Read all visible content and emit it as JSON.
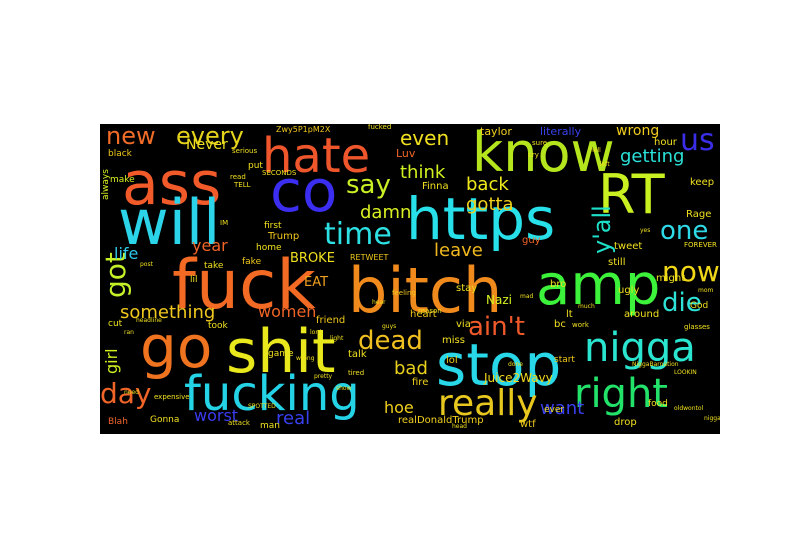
{
  "words": [
    {
      "text": "hate",
      "color": "#f0562c"
    },
    {
      "text": "know",
      "color": "#b5e61d"
    },
    {
      "text": "ass",
      "color": "#f25a2a"
    },
    {
      "text": "co",
      "color": "#3b2ef0"
    },
    {
      "text": "RT",
      "color": "#c9f020"
    },
    {
      "text": "will",
      "color": "#2bd4e8"
    },
    {
      "text": "https",
      "color": "#27e0ea"
    },
    {
      "text": "fuck",
      "color": "#f26a24"
    },
    {
      "text": "bitch",
      "color": "#f08a1c"
    },
    {
      "text": "amp",
      "color": "#3cf23a"
    },
    {
      "text": "go",
      "color": "#f07420"
    },
    {
      "text": "shit",
      "color": "#e8e81c"
    },
    {
      "text": "stop",
      "color": "#28d8e8"
    },
    {
      "text": "nigga",
      "color": "#2ae6d0"
    },
    {
      "text": "fucking",
      "color": "#25d3e6"
    },
    {
      "text": "really",
      "color": "#e8c81e"
    },
    {
      "text": "right",
      "color": "#22e26a"
    },
    {
      "text": "time",
      "color": "#2ce0e4"
    },
    {
      "text": "now",
      "color": "#f0d818"
    },
    {
      "text": "say",
      "color": "#c8f024"
    },
    {
      "text": "new",
      "color": "#f06c28"
    },
    {
      "text": "every",
      "color": "#e6d41c"
    },
    {
      "text": "us",
      "color": "#3a2ee8"
    },
    {
      "text": "one",
      "color": "#2edae8"
    },
    {
      "text": "y'all",
      "color": "#1ee0c8"
    },
    {
      "text": "die",
      "color": "#2ee2d8"
    },
    {
      "text": "ain't",
      "color": "#f05a2a"
    },
    {
      "text": "dead",
      "color": "#f0c020"
    },
    {
      "text": "got",
      "color": "#c4f028"
    },
    {
      "text": "day",
      "color": "#f06428"
    },
    {
      "text": "even",
      "color": "#f0e020"
    },
    {
      "text": "think",
      "color": "#d0f020"
    },
    {
      "text": "back",
      "color": "#f0ea1c"
    },
    {
      "text": "gotta",
      "color": "#f0d01c"
    },
    {
      "text": "damn",
      "color": "#d8f022"
    },
    {
      "text": "leave",
      "color": "#f0b81e"
    },
    {
      "text": "getting",
      "color": "#2ae0d8"
    },
    {
      "text": "wrong",
      "color": "#f0cc1c"
    },
    {
      "text": "something",
      "color": "#f0c81e"
    },
    {
      "text": "women",
      "color": "#f06426"
    },
    {
      "text": "bad",
      "color": "#e8d01c"
    },
    {
      "text": "want",
      "color": "#3a40f0"
    },
    {
      "text": "worst",
      "color": "#3a3cf0"
    },
    {
      "text": "real",
      "color": "#3840f0"
    },
    {
      "text": "hoe",
      "color": "#f0d01c"
    },
    {
      "text": "girl",
      "color": "#d0f020"
    },
    {
      "text": "life",
      "color": "#2cc8e8"
    },
    {
      "text": "year",
      "color": "#f06428"
    },
    {
      "text": "Never",
      "color": "#f0e020"
    },
    {
      "text": "BROKE",
      "color": "#f0e020"
    },
    {
      "text": "EAT",
      "color": "#f0a01e"
    },
    {
      "text": "Juice2Wavy",
      "color": "#f0d81c"
    },
    {
      "text": "realDonaldTrump",
      "color": "#f0d01c"
    },
    {
      "text": "Nazi",
      "color": "#d8f020"
    },
    {
      "text": "taylor",
      "color": "#f0d01e"
    },
    {
      "text": "literally",
      "color": "#3a40f0"
    },
    {
      "text": "Luv",
      "color": "#f06428"
    },
    {
      "text": "Finna",
      "color": "#f0e020"
    },
    {
      "text": "Trump",
      "color": "#f0c81c"
    },
    {
      "text": "bro",
      "color": "#f0e020"
    },
    {
      "text": "stay",
      "color": "#f0e020"
    },
    {
      "text": "miss",
      "color": "#f0e020"
    },
    {
      "text": "heart",
      "color": "#f0c81c"
    },
    {
      "text": "talk",
      "color": "#f0e020"
    },
    {
      "text": "friend",
      "color": "#f0c81c"
    },
    {
      "text": "fire",
      "color": "#f0d01c"
    },
    {
      "text": "lol",
      "color": "#f0d01c"
    },
    {
      "text": "via",
      "color": "#f0e020"
    },
    {
      "text": "wtf",
      "color": "#f0c81c"
    },
    {
      "text": "lt",
      "color": "#f0e020"
    },
    {
      "text": "bc",
      "color": "#f0e020"
    },
    {
      "text": "tweet",
      "color": "#f0e020"
    },
    {
      "text": "still",
      "color": "#f0e020"
    },
    {
      "text": "guy",
      "color": "#f06428"
    },
    {
      "text": "ugly",
      "color": "#f0e020"
    },
    {
      "text": "around",
      "color": "#f0e020"
    },
    {
      "text": "drop",
      "color": "#f0e020"
    },
    {
      "text": "might",
      "color": "#f0e020"
    },
    {
      "text": "Rage",
      "color": "#f0e020"
    },
    {
      "text": "keep",
      "color": "#f0e020"
    },
    {
      "text": "hour",
      "color": "#f0e020"
    },
    {
      "text": "black",
      "color": "#f0c81c"
    },
    {
      "text": "make",
      "color": "#d8f020"
    },
    {
      "text": "always",
      "color": "#d8f020"
    },
    {
      "text": "home",
      "color": "#f0e020"
    },
    {
      "text": "first",
      "color": "#f0e020"
    },
    {
      "text": "put",
      "color": "#f0e020"
    },
    {
      "text": "take",
      "color": "#f0e020"
    },
    {
      "text": "fake",
      "color": "#f0c81c"
    },
    {
      "text": "lil",
      "color": "#f0e020"
    },
    {
      "text": "cut",
      "color": "#f0e020"
    },
    {
      "text": "game",
      "color": "#f0e020"
    },
    {
      "text": "took",
      "color": "#f0e020"
    },
    {
      "text": "Blah",
      "color": "#f06428"
    },
    {
      "text": "Gonna",
      "color": "#f0e020"
    },
    {
      "text": "man",
      "color": "#f0e020"
    },
    {
      "text": "ever",
      "color": "#f0e020"
    },
    {
      "text": "start",
      "color": "#f0c81c"
    },
    {
      "text": "food",
      "color": "#f0e020"
    },
    {
      "text": "God",
      "color": "#f0e020"
    },
    {
      "text": "RETWEET",
      "color": "#f0c81c"
    },
    {
      "text": "Zwy5P1pM2X",
      "color": "#f0c81c"
    },
    {
      "text": "fucked",
      "color": "#f0e020"
    },
    {
      "text": "serious",
      "color": "#f0e020"
    },
    {
      "text": "IM",
      "color": "#f0e020"
    },
    {
      "text": "read",
      "color": "#f0e020"
    },
    {
      "text": "TELL",
      "color": "#f0e020"
    },
    {
      "text": "SECONDS",
      "color": "#f0e020"
    },
    {
      "text": "feeling",
      "color": "#f0c81c"
    },
    {
      "text": "reason",
      "color": "#f0e020"
    },
    {
      "text": "expensive",
      "color": "#f0e020"
    },
    {
      "text": "attack",
      "color": "#f0e020"
    },
    {
      "text": "tired",
      "color": "#f0e020"
    },
    {
      "text": "sure",
      "color": "#f0e020"
    },
    {
      "text": "cry",
      "color": "#f0e020"
    },
    {
      "text": "work",
      "color": "#f0e020"
    },
    {
      "text": "FOREVER",
      "color": "#f0e020"
    },
    {
      "text": "glasses",
      "color": "#f0e020"
    },
    {
      "text": "SPOTTED",
      "color": "#f0e020"
    },
    {
      "text": "NiggaBarnation",
      "color": "#f0e020"
    },
    {
      "text": "LOOKIN",
      "color": "#f0e020"
    },
    {
      "text": "oldwontol",
      "color": "#f0e020"
    },
    {
      "text": "head",
      "color": "#f0e020"
    },
    {
      "text": "headline",
      "color": "#f0e020"
    },
    {
      "text": "ran",
      "color": "#f0e020"
    },
    {
      "text": "post",
      "color": "#f0e020"
    },
    {
      "text": "need",
      "color": "#f0e020"
    },
    {
      "text": "lord",
      "color": "#f0e020"
    },
    {
      "text": "hear",
      "color": "#f0e020"
    },
    {
      "text": "wrong",
      "color": "#f0e020"
    },
    {
      "text": "light",
      "color": "#f0e020"
    },
    {
      "text": "pretty",
      "color": "#f0e020"
    },
    {
      "text": "show",
      "color": "#f0e020"
    },
    {
      "text": "guys",
      "color": "#f0e020"
    },
    {
      "text": "done",
      "color": "#f0e020"
    },
    {
      "text": "mad",
      "color": "#f0e020"
    },
    {
      "text": "hell",
      "color": "#f0e020"
    },
    {
      "text": "left",
      "color": "#f0e020"
    },
    {
      "text": "much",
      "color": "#f0e020"
    },
    {
      "text": "yes",
      "color": "#f0e020"
    },
    {
      "text": "mom",
      "color": "#f0e020"
    },
    {
      "text": "nigga",
      "color": "#f0e020"
    }
  ]
}
